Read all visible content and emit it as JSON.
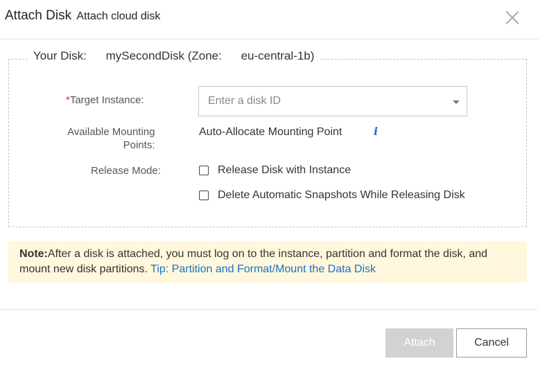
{
  "dialog": {
    "title": "Attach Disk",
    "subtitle": "Attach cloud disk"
  },
  "disk_info": {
    "prefix": "Your Disk:",
    "name": "mySecondDisk (Zone:",
    "zone": "eu-central-1b)"
  },
  "form": {
    "target_instance": {
      "required_mark": "*",
      "label": "Target Instance:",
      "placeholder": "Enter a disk ID"
    },
    "mounting_points": {
      "label_line1": "Available Mounting",
      "label_line2": "Points:",
      "value": "Auto-Allocate Mounting Point",
      "info_icon": "i"
    },
    "release_mode": {
      "label": "Release Mode:",
      "options": [
        {
          "label": "Release Disk with Instance",
          "checked": false
        },
        {
          "label": "Delete Automatic Snapshots While Releasing Disk",
          "checked": false
        }
      ]
    }
  },
  "note": {
    "prefix": "Note:",
    "text": "After a disk is attached, you must log on to the instance, partition and format the disk, and mount new disk partitions. ",
    "link": "Tip: Partition and Format/Mount the Data Disk"
  },
  "footer": {
    "attach_label": "Attach",
    "cancel_label": "Cancel"
  },
  "colors": {
    "required": "#d93026",
    "link": "#1a6fd1",
    "note_bg": "#fff8dc",
    "disabled_button": "#d2d2d2"
  }
}
